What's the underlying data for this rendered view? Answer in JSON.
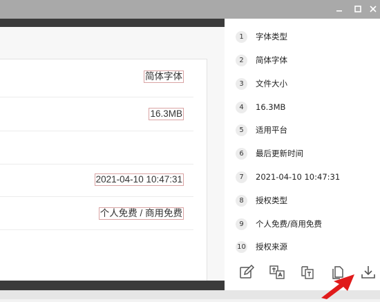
{
  "window": {
    "minimize_icon": "minimize-icon",
    "maximize_icon": "maximize-icon",
    "close_icon": "close-icon"
  },
  "main": {
    "values": [
      "简体字体",
      "16.3MB",
      "2021-04-10 10:47:31",
      "个人免费 / 商用免费"
    ]
  },
  "sidebar": {
    "items": [
      {
        "num": "1",
        "label": "字体类型"
      },
      {
        "num": "2",
        "label": "简体字体"
      },
      {
        "num": "3",
        "label": "文件大小"
      },
      {
        "num": "4",
        "label": "16.3MB"
      },
      {
        "num": "5",
        "label": "适用平台"
      },
      {
        "num": "6",
        "label": "最后更新时间"
      },
      {
        "num": "7",
        "label": "2021-04-10 10:47:31"
      },
      {
        "num": "8",
        "label": "授权类型"
      },
      {
        "num": "9",
        "label": "个人免费/商用免费"
      },
      {
        "num": "10",
        "label": "授权来源"
      }
    ]
  },
  "toolbar": {
    "icons": [
      "edit-icon",
      "translate-icon",
      "copy-text-icon",
      "copy-icon",
      "download-icon"
    ]
  },
  "colors": {
    "accent_arrow": "#e01b1b",
    "highlight_border": "#d9a3a3"
  }
}
